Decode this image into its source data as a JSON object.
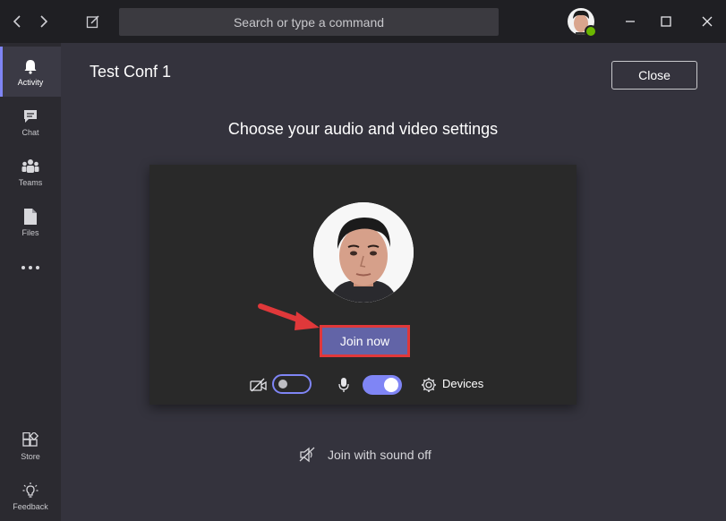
{
  "titlebar": {
    "search_placeholder": "Search or type a command"
  },
  "rail": {
    "items": [
      {
        "label": "Activity",
        "icon": "bell-icon",
        "active": true
      },
      {
        "label": "Chat",
        "icon": "chat-icon"
      },
      {
        "label": "Teams",
        "icon": "teams-icon"
      },
      {
        "label": "Files",
        "icon": "file-icon"
      },
      {
        "label": "",
        "icon": "more-icon"
      }
    ],
    "bottom_items": [
      {
        "label": "Store",
        "icon": "store-icon"
      },
      {
        "label": "Feedback",
        "icon": "feedback-icon"
      }
    ]
  },
  "meeting": {
    "title": "Test Conf 1",
    "close_label": "Close",
    "heading": "Choose your audio and video settings",
    "join_label": "Join now",
    "camera_on": false,
    "mic_on": true,
    "devices_label": "Devices",
    "sound_off_label": "Join with sound off"
  },
  "colors": {
    "accent": "#6264a7",
    "highlight": "#e0383a",
    "status_available": "#6bb700"
  }
}
